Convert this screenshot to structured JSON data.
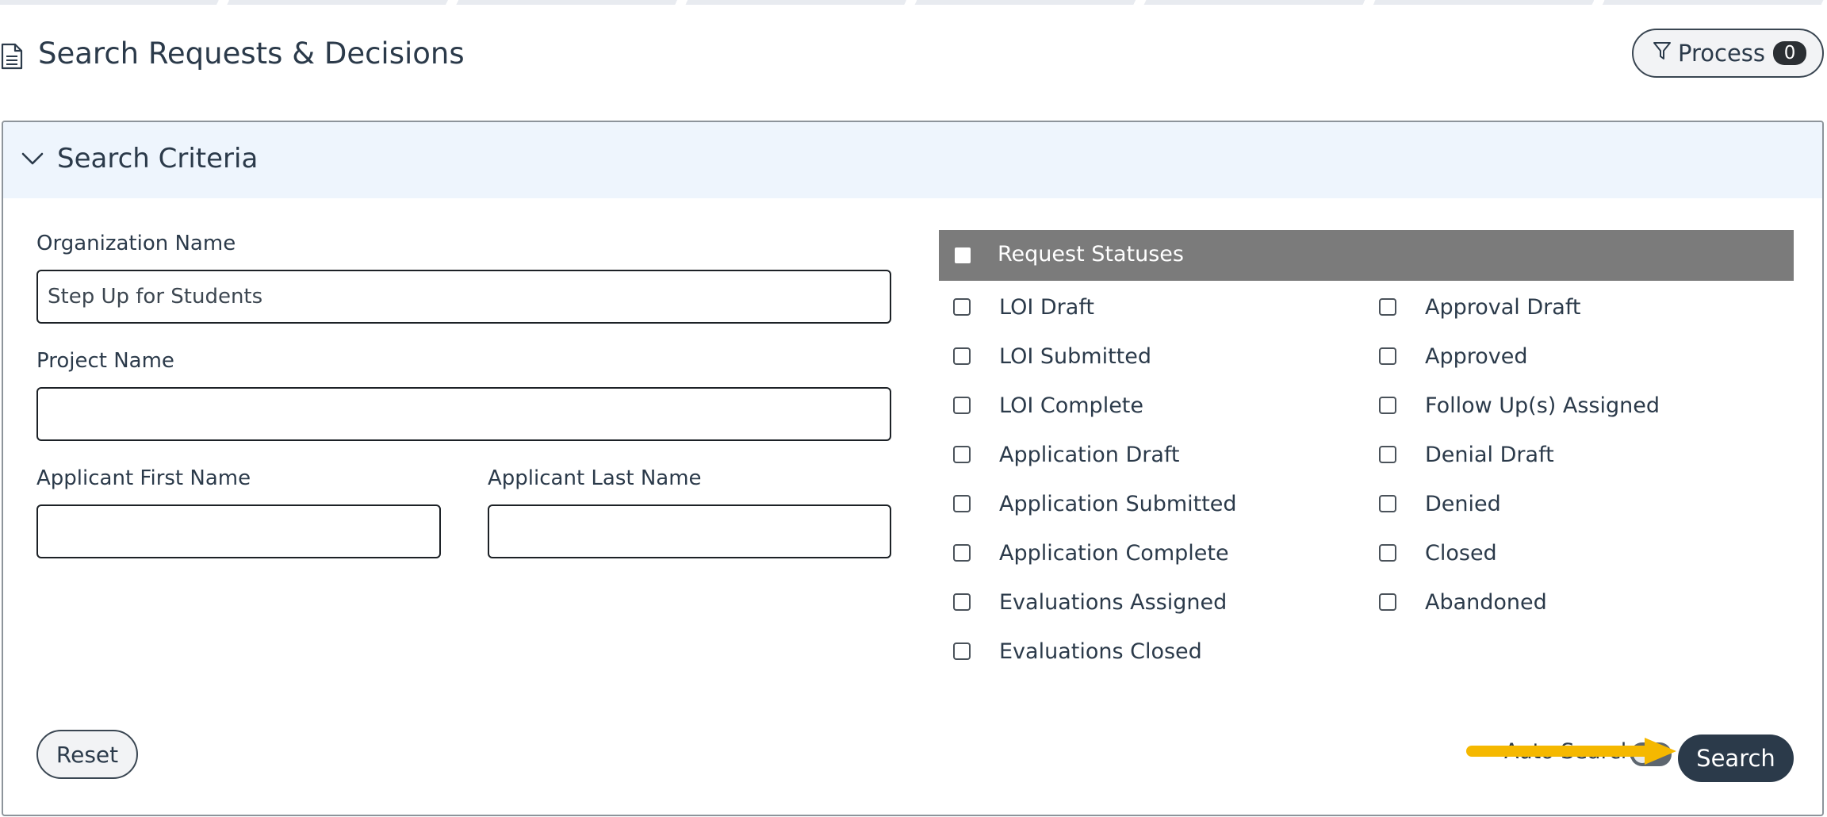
{
  "page": {
    "title": "Search Requests & Decisions",
    "process_button": {
      "label": "Process",
      "count": "0"
    }
  },
  "criteria": {
    "title": "Search Criteria",
    "fields": {
      "organization_name": {
        "label": "Organization Name",
        "value": "Step Up for Students"
      },
      "project_name": {
        "label": "Project Name",
        "value": ""
      },
      "applicant_first_name": {
        "label": "Applicant First Name",
        "value": ""
      },
      "applicant_last_name": {
        "label": "Applicant Last Name",
        "value": ""
      }
    },
    "request_statuses": {
      "header": "Request Statuses",
      "left": [
        "LOI Draft",
        "LOI Submitted",
        "LOI Complete",
        "Application Draft",
        "Application Submitted",
        "Application Complete",
        "Evaluations Assigned",
        "Evaluations Closed"
      ],
      "right": [
        "Approval Draft",
        "Approved",
        "Follow Up(s) Assigned",
        "Denial Draft",
        "Denied",
        "Closed",
        "Abandoned"
      ]
    },
    "actions": {
      "reset_label": "Reset",
      "auto_search_label": "Auto Search",
      "search_label": "Search"
    }
  },
  "colors": {
    "primary_dark": "#2b3a4a",
    "criteria_header_bg": "#eef5fd",
    "status_header_bg": "#7b7b7b",
    "annotation_arrow": "#f5b800"
  },
  "icons": {
    "page": "document-icon",
    "filter": "filter-icon",
    "collapse": "chevron-down-icon"
  }
}
